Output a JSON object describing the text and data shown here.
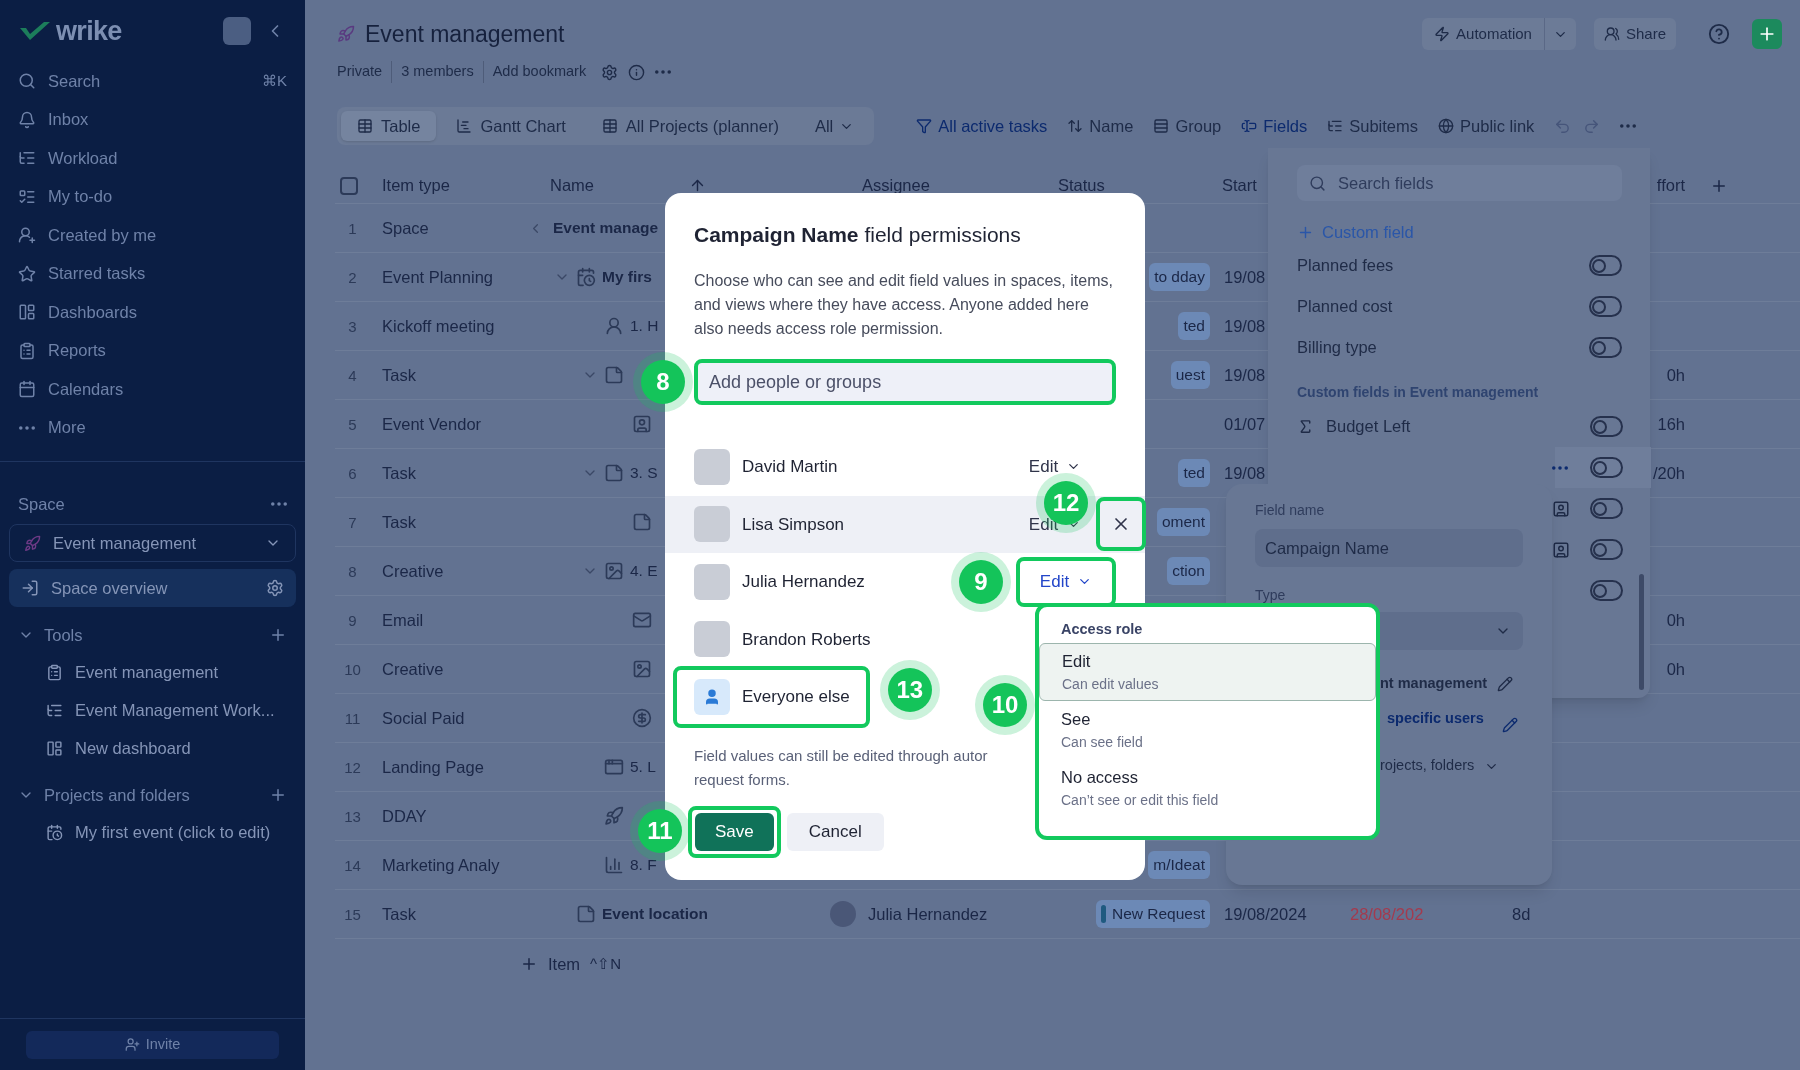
{
  "sidebar": {
    "logo": "wrike",
    "nav": [
      {
        "label": "Search",
        "shortcut": "⌘K",
        "kind": "search"
      },
      {
        "label": "Inbox",
        "kind": "inbox"
      },
      {
        "label": "Workload",
        "kind": "workload"
      },
      {
        "label": "My to-do",
        "kind": "todo"
      },
      {
        "label": "Created by me",
        "kind": "created"
      },
      {
        "label": "Starred tasks",
        "kind": "starred"
      },
      {
        "label": "Dashboards",
        "kind": "dashboards"
      },
      {
        "label": "Reports",
        "kind": "reports"
      },
      {
        "label": "Calendars",
        "kind": "calendars"
      },
      {
        "label": "More",
        "kind": "more"
      }
    ],
    "space_label": "Space",
    "space": "Event management",
    "overview": {
      "label": "Space overview",
      "selected": true
    },
    "groups": [
      {
        "label": "Tools",
        "expanded": true,
        "children": [
          {
            "label": "Event management",
            "kind": "reports"
          },
          {
            "label": "Event Management Work...",
            "kind": "workload"
          },
          {
            "label": "New dashboard",
            "kind": "dashboards"
          }
        ]
      },
      {
        "label": "Projects and folders",
        "expanded": true,
        "children": [
          {
            "label": "My first event (click to edit)",
            "kind": "project"
          }
        ]
      }
    ],
    "invite": "Invite"
  },
  "header": {
    "title": "Event management",
    "meta": [
      "Private",
      "3 members",
      "Add bookmark"
    ],
    "automation": "Automation",
    "share": "Share"
  },
  "toolbar": {
    "views": [
      {
        "label": "Table",
        "kind": "table",
        "selected": true
      },
      {
        "label": "Gantt Chart",
        "kind": "gantt",
        "selected": false
      },
      {
        "label": "All Projects (planner)",
        "kind": "table",
        "selected": false
      }
    ],
    "scope": "All",
    "tools": [
      {
        "label": "All active tasks",
        "kind": "filter",
        "active": true
      },
      {
        "label": "Name",
        "kind": "sort",
        "active": false
      },
      {
        "label": "Group",
        "kind": "group",
        "active": false
      },
      {
        "label": "Fields",
        "kind": "fields",
        "active": true
      },
      {
        "label": "Subitems",
        "kind": "subitems",
        "active": false
      },
      {
        "label": "Public link",
        "kind": "link",
        "active": false
      }
    ]
  },
  "table": {
    "select_all": {
      "checked": false
    },
    "columns": {
      "item_type": "Item type",
      "name": "Name",
      "assignee": "Assignee",
      "status": "Status",
      "start": "Start",
      "effort": "ffort"
    },
    "rows": [
      {
        "num": "1",
        "type": "Space",
        "name": "Event manage",
        "kind": "space",
        "expanded": false
      },
      {
        "num": "2",
        "type": "Event Planning",
        "name": "My firs",
        "kind": "project",
        "expanded": true,
        "status": "to dday",
        "start": "19/08",
        "children": [
          {
            "num": "3",
            "type": "Kickoff meeting",
            "name": "1. H",
            "kind": "meeting",
            "expanded": false,
            "status": "ted",
            "start": "19/08"
          },
          {
            "num": "4",
            "type": "Task",
            "kind": "task",
            "expanded": true,
            "status": "uest",
            "start": "19/08",
            "effort": "0h",
            "children": [
              {
                "num": "5",
                "type": "Event Vendor",
                "kind": "vendor",
                "expanded": false,
                "start": "01/07",
                "effort": "16h"
              }
            ]
          },
          {
            "num": "6",
            "type": "Task",
            "name": "3. S",
            "kind": "task",
            "expanded": true,
            "status": "ted",
            "start": "19/08",
            "effort": "/20h",
            "children": [
              {
                "num": "7",
                "type": "Task",
                "kind": "task",
                "expanded": false,
                "status": "oment"
              }
            ]
          },
          {
            "num": "8",
            "type": "Creative",
            "name": "4. E",
            "kind": "creative",
            "expanded": true,
            "status": "ction",
            "children": [
              {
                "num": "9",
                "type": "Email",
                "kind": "email",
                "expanded": false,
                "effort": "0h"
              },
              {
                "num": "10",
                "type": "Creative",
                "kind": "creative",
                "expanded": false,
                "effort": "0h"
              },
              {
                "num": "11",
                "type": "Social Paid",
                "kind": "payment",
                "expanded": false
              }
            ]
          },
          {
            "num": "12",
            "type": "Landing Page",
            "name": "5. L",
            "kind": "page",
            "expanded": false
          },
          {
            "num": "13",
            "type": "DDAY",
            "kind": "launch",
            "expanded": false
          },
          {
            "num": "14",
            "type": "Marketing Analy",
            "name": "8. F",
            "kind": "analytics",
            "expanded": false,
            "status": "m/Ideat"
          }
        ]
      },
      {
        "num": "15",
        "type": "Task",
        "name": "Event location",
        "kind": "task",
        "expanded": false,
        "assignee": "Julia Hernandez",
        "status": "New Request",
        "color": "#1f5a80",
        "start": "19/08/2024",
        "due": "28/08/202",
        "overdue": true,
        "duration": "8d"
      }
    ],
    "add_item": {
      "label": "Item",
      "shortcut": "^⇧N"
    }
  },
  "fields_panel": {
    "search_placeholder": "Search fields",
    "add": "Custom field",
    "fields": [
      {
        "name": "Planned fees",
        "on": false
      },
      {
        "name": "Planned cost",
        "on": false
      },
      {
        "name": "Billing type",
        "on": false
      }
    ],
    "section": "Custom fields in Event management",
    "custom_fields": [
      {
        "name": "Budget Left",
        "kind": "sum",
        "on": false,
        "selected": false
      },
      {
        "kind": "menu",
        "on": false,
        "selected": true
      },
      {
        "kind": "person",
        "on": false,
        "selected": false
      },
      {
        "kind": "person",
        "on": false,
        "selected": false
      },
      {
        "kind": "blank",
        "on": false,
        "selected": false
      }
    ]
  },
  "field_editor": {
    "name_label": "Field name",
    "name_value": "Campaign Name",
    "type_label": "Type",
    "shared_in": "nt management",
    "access": "specific users",
    "scope": "rojects, folders"
  },
  "modal": {
    "title": "**Campaign Name** field permissions",
    "description": "Choose who can see and edit field values in spaces, items, and views where they have access. Anyone added here also needs access role permission.",
    "input": {
      "placeholder": "Add people or groups",
      "callout": "8"
    },
    "people": [
      {
        "name": "David Martin",
        "kind": "person",
        "role": "Edit",
        "selected": false,
        "open": false
      },
      {
        "name": "Lisa Simpson",
        "kind": "person",
        "role": "Edit",
        "selected": true,
        "open": false,
        "remove_callout": "12"
      },
      {
        "name": "Julia Hernandez",
        "kind": "person",
        "role": "Edit",
        "selected": false,
        "open": true,
        "callout": "9"
      },
      {
        "name": "Brandon Roberts",
        "kind": "person",
        "selected": false
      },
      {
        "name": "Everyone else",
        "kind": "everyone",
        "selected": false,
        "callout": "13"
      }
    ],
    "note_lines": [
      "Field values can still be edited through autor",
      "request forms."
    ],
    "save": {
      "label": "Save",
      "callout": "11"
    },
    "cancel": "Cancel"
  },
  "menu": {
    "title": "Access role",
    "callout": "10",
    "options": [
      {
        "label": "Edit",
        "description": "Can edit values",
        "selected": true
      },
      {
        "label": "See",
        "description": "Can see field",
        "selected": false
      },
      {
        "label": "No access",
        "description": "Can’t see or edit this field",
        "selected": false
      }
    ]
  }
}
